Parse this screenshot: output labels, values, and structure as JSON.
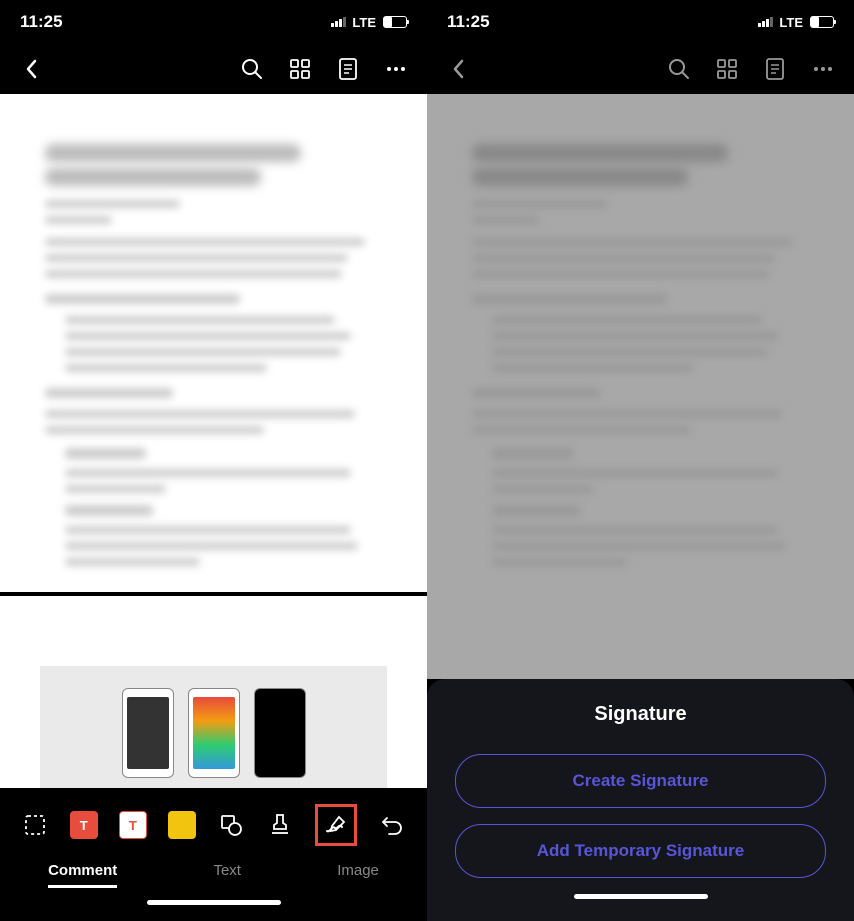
{
  "status": {
    "time": "11:25",
    "network": "LTE"
  },
  "toolbar_tabs": {
    "comment": "Comment",
    "text": "Text",
    "image": "Image"
  },
  "sheet": {
    "title": "Signature",
    "create": "Create Signature",
    "temporary": "Add Temporary Signature"
  },
  "tool_t": "T",
  "colors": {
    "accent": "#5856d6",
    "highlight": "#e74c3c"
  }
}
